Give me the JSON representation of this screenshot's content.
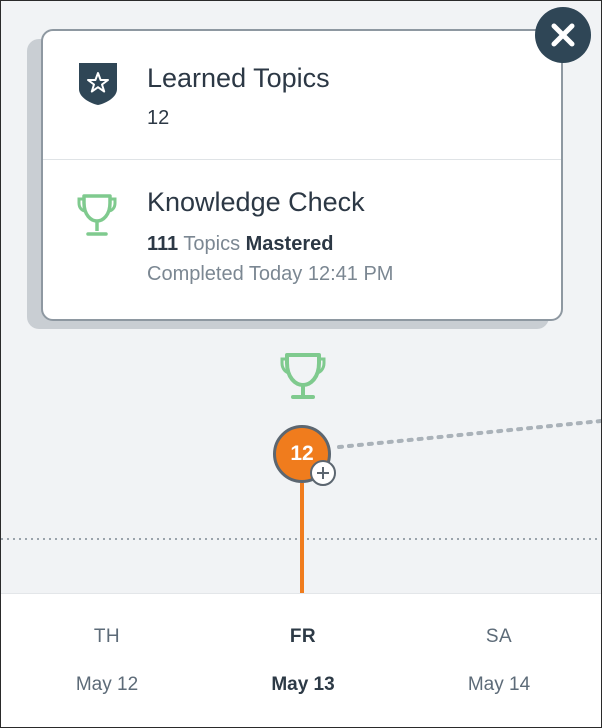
{
  "popover": {
    "learned": {
      "title": "Learned Topics",
      "count": "12"
    },
    "knowledge_check": {
      "title": "Knowledge Check",
      "topics_count": "111",
      "topics_word": "Topics",
      "status_word": "Mastered",
      "completed": "Completed Today 12:41 PM"
    }
  },
  "timeline": {
    "node_label": "12",
    "days": [
      {
        "dow": "TH",
        "date": "May 12",
        "active": false
      },
      {
        "dow": "FR",
        "date": "May 13",
        "active": true
      },
      {
        "dow": "SA",
        "date": "May 14",
        "active": false
      }
    ]
  },
  "colors": {
    "accent_orange": "#f07c1d",
    "trophy_green": "#7fca8e",
    "shield_navy": "#2f4656"
  },
  "icons": {
    "close": "close-icon",
    "shield": "shield-star-icon",
    "trophy": "trophy-icon",
    "plus": "plus-icon"
  }
}
